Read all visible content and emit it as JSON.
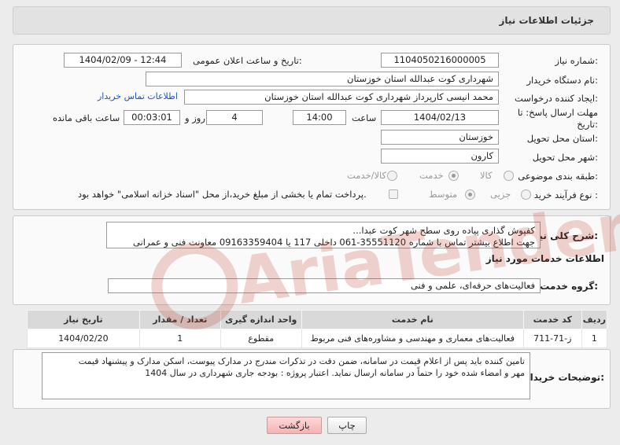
{
  "header": {
    "title": "جزئیات اطلاعات نیاز"
  },
  "form": {
    "need_number_label": "شماره نیاز:",
    "need_number": "1104050216000005",
    "announce_label": "تاریخ و ساعت اعلان عمومی:",
    "announce_value": "1404/02/09 - 12:44",
    "buyer_org_label": "نام دستگاه خریدار:",
    "buyer_org": "شهرداری کوت عبدالله استان خوزستان",
    "creator_label": "ایجاد کننده درخواست:",
    "creator": "محمد انیسی کارپرداز شهرداری کوت عبدالله استان خوزستان",
    "buyer_contact_link": "اطلاعات تماس خریدار",
    "deadline_label": "مهلت ارسال پاسخ: تا تاریخ:",
    "deadline_date": "1404/02/13",
    "time_label": "ساعت",
    "deadline_time": "14:00",
    "days_value": "4",
    "days_label": "روز و",
    "remaining_time": "00:03:01",
    "remaining_label": "ساعت باقی مانده",
    "province_label": "استان محل تحویل:",
    "province": "خوزستان",
    "city_label": "شهر محل تحویل:",
    "city": "کارون",
    "category_label": "طبقه بندی موضوعی:",
    "category_options": [
      "کالا",
      "خدمت",
      "کالا/خدمت"
    ],
    "category_selected": "خدمت",
    "process_label": "نوع فرآیند خرید :",
    "process_options": [
      "جزیی",
      "متوسط"
    ],
    "process_selected": "متوسط",
    "treasury_note": "پرداخت تمام یا بخشی از مبلغ خرید،از محل \"اسناد خزانه اسلامی\" خواهد بود."
  },
  "summary": {
    "label": "شرح کلی نیاز:",
    "line1": "کفپوش گذاری پیاده روی سطح شهر کوت عبدا...",
    "line2": "جهت اطلاع بیشتر تماس با شماره 35551120-061 داخلی 117 یا 09163359404 معاونت فنی و عمرانی"
  },
  "services": {
    "section_title": "اطلاعات خدمات مورد نیاز",
    "group_label": "گروه خدمت:",
    "group_value": "فعالیت‌های حرفه‌ای، علمی و فنی",
    "columns": [
      "ردیف",
      "کد خدمت",
      "نام خدمت",
      "واحد اندازه گیری",
      "تعداد / مقدار",
      "تاریخ نیاز"
    ],
    "rows": [
      [
        "1",
        "ز-71-711",
        "فعالیت‌های معماری و مهندسی و مشاوره‌های فنی مربوط",
        "مقطوع",
        "1",
        "1404/02/20"
      ]
    ]
  },
  "notes": {
    "label": "توضیحات خریدار:",
    "line1": "تامین کننده باید پس از اعلام قیمت در سامانه، ضمن دقت در تذکرات مندرج در مدارک پیوست، اسکن مدارک و پیشنهاد قیمت",
    "line2": "مهر و امضاء شده خود را حتماً در سامانه ارسال نماید. اعتبار پروژه : بودجه جاری شهرداری در سال 1404"
  },
  "buttons": {
    "print": "چاپ",
    "back": "بازگشت"
  },
  "watermark": {
    "text": "AriaTender.neT"
  }
}
